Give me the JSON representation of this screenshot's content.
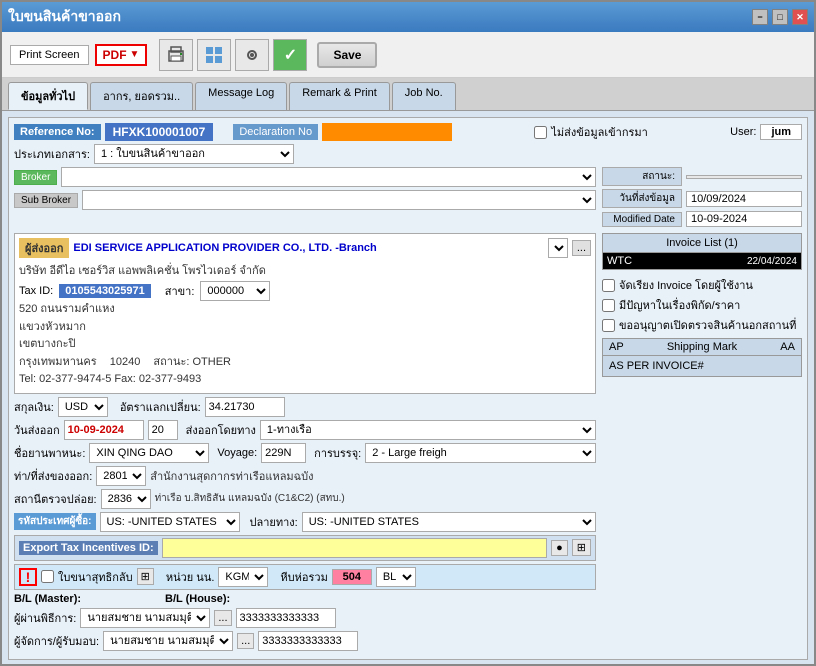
{
  "title": "ใบขนสินค้าขาออก",
  "toolbar": {
    "print_screen": "Print Screen",
    "pdf_label": "PDF",
    "save_label": "Save"
  },
  "tabs": {
    "tab1": "ข้อมูลทั่วไป",
    "tab2": "อากร, ยอดรวม..",
    "tab3": "Message Log",
    "tab4": "Remark & Print",
    "tab5": "Job No.",
    "active": "tab1"
  },
  "form": {
    "reference_no_label": "Reference No:",
    "reference_no_value": "HFXK100001007",
    "declaration_no_label": "Declaration No",
    "declaration_no_value": "",
    "no_send_data_label": "ไม่ส่งข้อมูลเข้ากรมา",
    "user_label": "User:",
    "user_value": "jum",
    "doc_type_label": "ประเภทเอกสาร:",
    "doc_type_value": "1 : ใบขนสินค้าขาออก",
    "broker_label": "Broker",
    "sub_broker_label": "Sub Broker",
    "status_label": "สถานะ:",
    "date_sent_label": "วันที่ส่งข้อมูล",
    "date_sent_value": "10/09/2024",
    "modified_date_label": "Modified Date",
    "modified_date_value": "10-09-2024",
    "sender_label": "ผู้ส่งออก",
    "sender_company": "EDI SERVICE APPLICATION PROVIDER CO., LTD. -Branch",
    "sender_company2": "บริษัท อีดีไอ เซอร์วิส แอพพลิเคชั่น โพรไวเดอร์ จำกัด",
    "tax_id_label": "Tax ID:",
    "tax_id_value": "0105543025971",
    "branch_label": "สาขา:",
    "branch_value": "000000",
    "address_line1": "520 ถนนรามคำแหง",
    "address_line2": "แขวงหัวหมาก",
    "address_line3": "เขตบางกะปิ",
    "address_line4": "กรุงเทพมหานคร",
    "address_postcode": "10240",
    "address_status": "สถานะ: OTHER",
    "address_tel": "Tel: 02-377-9474-5 Fax: 02-377-9493",
    "currency_label": "สกุลเงิน:",
    "currency_value": "USD",
    "exchange_rate_label": "อัตราแลกเปลี่ยน:",
    "exchange_rate_value": "34.21730",
    "export_date_label": "วันส่งออก",
    "export_date_value": "10-09-2024",
    "export_number": "20",
    "export_route_label": "ส่งออกโดยทาง",
    "export_route_value": "1-ทางเรือ",
    "vessel_label": "ชื่อยานพาหนะ:",
    "vessel_value": "XIN QING DAO",
    "voyage_label": "Voyage:",
    "voyage_value": "229N",
    "freight_label": "การบรรจุ:",
    "freight_value": "2 - Large freigh",
    "port_from_label": "ท่า/ที่ส่งของออก:",
    "port_from_value": "2801",
    "port_from_desc": "สำนักงานสุดกากรท่าเรือแหลมฉบัง",
    "station_label": "สถานีตรวจปล่อย:",
    "station_value": "2836",
    "station_desc": "ท่าเรือ บ.สิทธิสัน แหลมฉบัง (C1&C2) (สทบ.)",
    "country_label": "รหัสประเทศผู้ซื้อ:",
    "country_value": "US: -UNITED STATES",
    "dest_label": "ปลายทาง:",
    "dest_value": "US: -UNITED STATES",
    "export_tax_id_label": "Export Tax Incentives ID:",
    "warning_icon": "!",
    "customs_return_label": "ใบขนาสุทธิกลับ",
    "unit_label": "หน่วย นน.",
    "unit_value": "KGM",
    "total_label": "หีบห่อรวม",
    "total_value": "504",
    "total_unit": "BL",
    "bl_master_label": "B/L (Master):",
    "bl_house_label": "B/L (House):",
    "agent1_label": "ผู้ผ่านพิธีการ:",
    "agent1_value": "นายสมชาย นามสมมุติ",
    "agent1_phone": "3333333333333",
    "agent2_label": "ผู้จัดการ/ผู้รับมอบ:",
    "agent2_value": "นายสมชาย นามสมมุติ",
    "agent2_phone": "3333333333333",
    "invoice_list_header": "Invoice List (1)",
    "invoice_code": "WTC",
    "invoice_date": "22/04/2024",
    "checkbox1": "จัดเรียง Invoice โดยผู้ใช้งาน",
    "checkbox2": "มีปัญหาในเรื่องพิกัด/ราคา",
    "checkbox3": "ขออนุญาตเปิดตรวจสินค้านอกสถานที่",
    "shipping_mark_header": "Shipping Mark",
    "shipping_mark_value": "AS PER INVOICE#",
    "ap_label": "AP",
    "aa_label": "AA"
  },
  "window_controls": {
    "minimize": "−",
    "maximize": "□",
    "close": "✕"
  }
}
